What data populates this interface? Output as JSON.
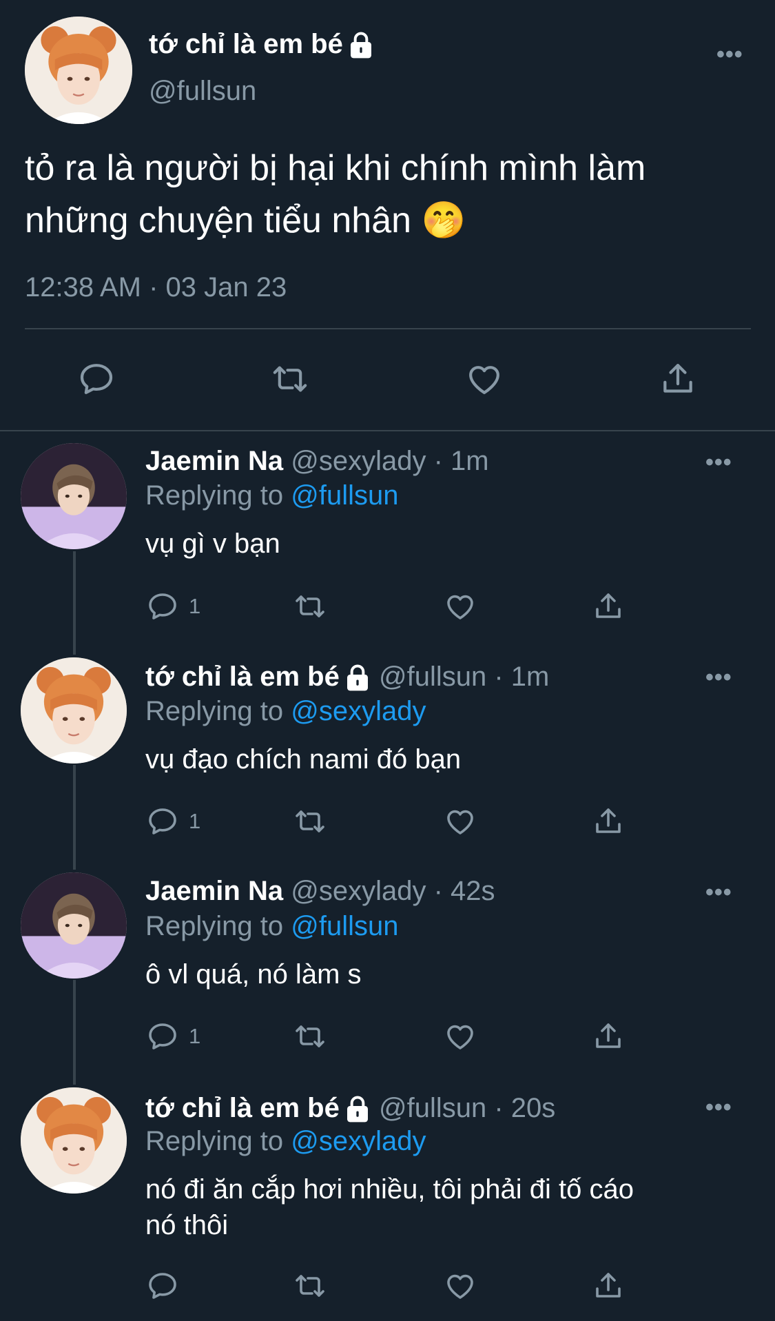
{
  "main_tweet": {
    "display_name": "tớ chỉ là em bé",
    "handle": "@fullsun",
    "text_line1": "tỏ ra là người bị hại khi chính mình làm",
    "text_line2": "những chuyện tiểu nhân",
    "emoji": "🤭",
    "timestamp": "12:38 AM · 03 Jan 23",
    "more": "•••"
  },
  "replies": [
    {
      "display_name": "Jaemin Na",
      "meta": "@sexylady · 1m",
      "replying_prefix": "Replying to ",
      "replying_to": "@fullsun",
      "text": "vụ gì v bạn",
      "reply_count": "1",
      "locked": false,
      "more": "•••"
    },
    {
      "display_name": "tớ chỉ là em bé",
      "meta": "@fullsun · 1m",
      "replying_prefix": "Replying to ",
      "replying_to": "@sexylady",
      "text": "vụ đạo chích nami đó bạn",
      "reply_count": "1",
      "locked": true,
      "more": "•••"
    },
    {
      "display_name": "Jaemin Na",
      "meta": "@sexylady · 42s",
      "replying_prefix": "Replying to ",
      "replying_to": "@fullsun",
      "text": "ô vl quá, nó làm s",
      "reply_count": "1",
      "locked": false,
      "more": "•••"
    },
    {
      "display_name": "tớ chỉ là em bé",
      "meta": "@fullsun · 20s",
      "replying_prefix": "Replying to ",
      "replying_to": "@sexylady",
      "text_line1": "nó đi ăn cắp hơi nhiều, tôi phải đi tố cáo",
      "text_line2": "nó thôi",
      "reply_count": "",
      "locked": true,
      "more": "•••"
    }
  ],
  "colors": {
    "background": "#15202b",
    "muted": "#8899a6",
    "link": "#1d9bf0",
    "divider": "#38444d"
  },
  "icons": [
    "reply-icon",
    "retweet-icon",
    "like-icon",
    "share-icon",
    "lock-icon",
    "more-icon"
  ]
}
